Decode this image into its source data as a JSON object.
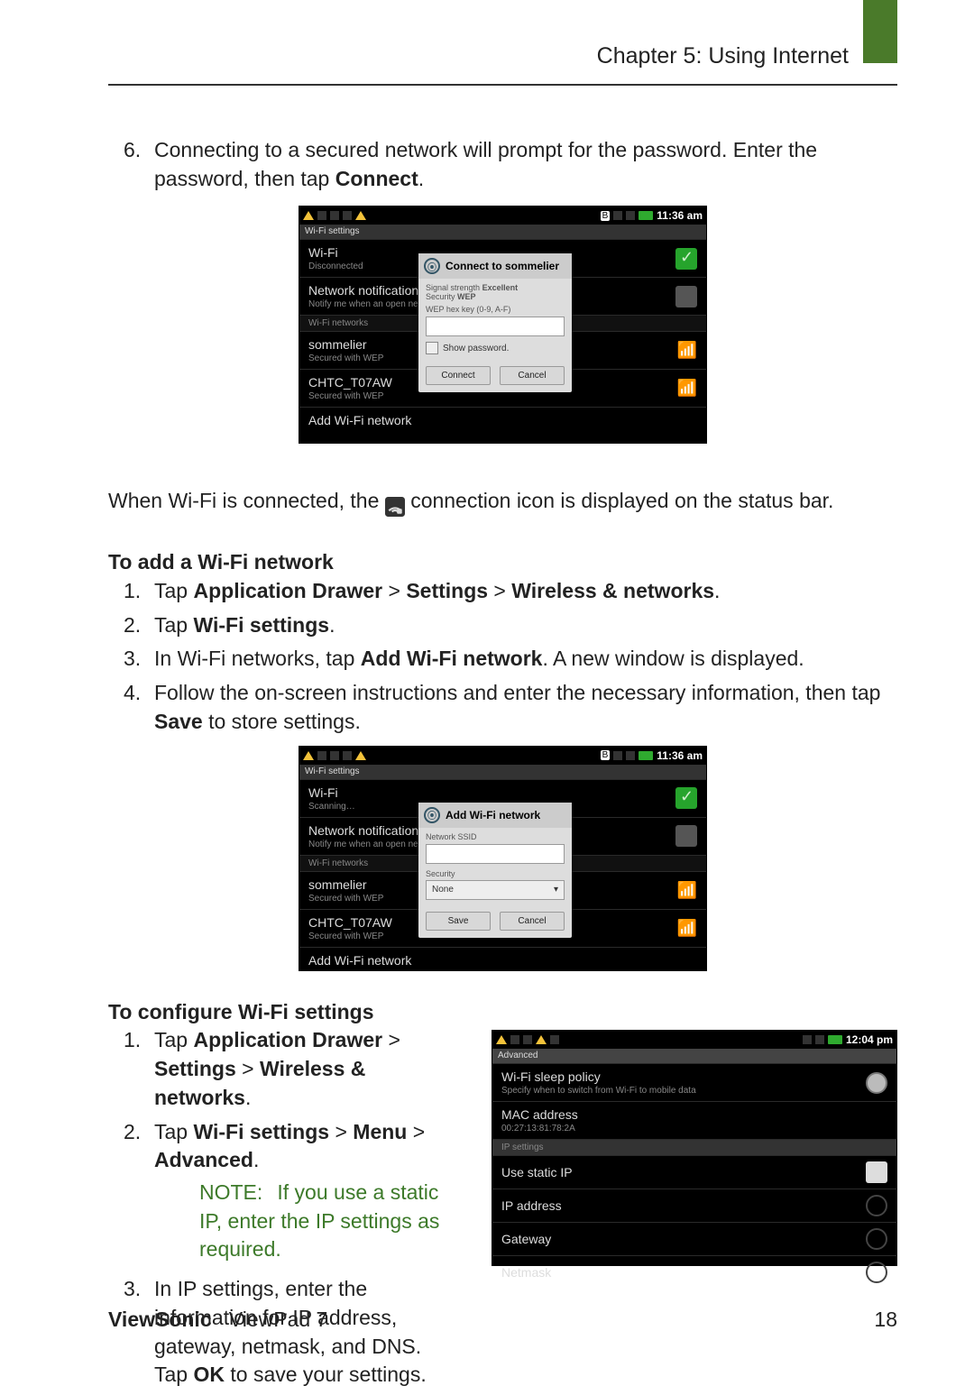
{
  "header": {
    "chapter_title": "Chapter 5: Using Internet"
  },
  "p_intro": {
    "num": "6.",
    "text_a": "Connecting to a secured network will prompt for the password. Enter the password, then tap ",
    "bold": "Connect",
    "text_b": "."
  },
  "screenshot1": {
    "time": "11:36 am",
    "titlebar": "Wi-Fi settings",
    "rows": {
      "wifi_title": "Wi-Fi",
      "wifi_sub": "Disconnected",
      "notif_title": "Network notification",
      "notif_sub": "Notify me when an open network is a…",
      "section_label": "Wi-Fi networks",
      "net1_title": "sommelier",
      "net1_sub": "Secured with WEP",
      "net2_title": "CHTC_T07AW",
      "net2_sub": "Secured with WEP",
      "add_title": "Add Wi-Fi network"
    },
    "dialog": {
      "title": "Connect to sommelier",
      "line1a": "Signal strength",
      "line1b": "Excellent",
      "line2a": "Security",
      "line2b": "WEP",
      "line3": "WEP hex key (0-9, A-F)",
      "show_pw": "Show password.",
      "btn_ok": "Connect",
      "btn_cancel": "Cancel"
    }
  },
  "p_connected": {
    "a": "When Wi-Fi is connected, the ",
    "b": " connection icon is displayed on the status bar."
  },
  "add_section": {
    "heading": "To add a Wi-Fi network",
    "s1": {
      "num": "1.",
      "a": "Tap ",
      "b1": "Application Drawer",
      "b2": "Settings",
      "b3": "Wireless & networks",
      "gt": " > ",
      "end": "."
    },
    "s2": {
      "num": "2.",
      "a": "Tap ",
      "b": "Wi-Fi settings",
      "end": "."
    },
    "s3": {
      "num": "3.",
      "a": "In Wi-Fi networks, tap ",
      "b": "Add Wi-Fi network",
      "c": ". A new window is displayed."
    },
    "s4": {
      "num": "4.",
      "a": "Follow the on-screen instructions and enter the necessary information, then tap ",
      "b": "Save",
      "c": " to store settings."
    }
  },
  "screenshot2": {
    "time": "11:36 am",
    "titlebar": "Wi-Fi settings",
    "rows": {
      "wifi_title": "Wi-Fi",
      "wifi_sub": "Scanning…",
      "notif_title": "Network notification",
      "notif_sub": "Notify me when an open network is a…",
      "section_label": "Wi-Fi networks",
      "net1_title": "sommelier",
      "net1_sub": "Secured with WEP",
      "net2_title": "CHTC_T07AW",
      "net2_sub": "Secured with WEP",
      "add_title": "Add Wi-Fi network"
    },
    "dialog": {
      "title": "Add Wi-Fi network",
      "lbl_ssid": "Network SSID",
      "lbl_sec": "Security",
      "sec_value": "None",
      "btn_ok": "Save",
      "btn_cancel": "Cancel"
    }
  },
  "config_section": {
    "heading": "To configure Wi-Fi settings",
    "s1": {
      "num": "1.",
      "a": "Tap ",
      "b1": "Application Drawer",
      "b2": "Settings",
      "b3": "Wireless & networks",
      "gt": " > ",
      "end": "."
    },
    "s2": {
      "num": "2.",
      "a": "Tap ",
      "b1": "Wi-Fi settings",
      "b2": "Menu",
      "b3": "Advanced",
      "gt": " > ",
      "end": "."
    },
    "note": {
      "label": "NOTE:",
      "text": " If you use a static IP, enter the IP settings as required."
    },
    "s3": {
      "num": "3.",
      "a": "In IP settings, enter the information for IP address, gateway, netmask, and DNS. Tap ",
      "b": "OK",
      "c": " to save your settings."
    }
  },
  "screenshot3": {
    "time": "12:04 pm",
    "titlebar": "Advanced",
    "rows": {
      "sleep_title": "Wi-Fi sleep policy",
      "sleep_sub": "Specify when to switch from Wi-Fi to mobile data",
      "mac_title": "MAC address",
      "mac_sub": "00:27:13:81:78:2A",
      "section_label": "IP settings",
      "static_title": "Use static IP",
      "ip_title": "IP address",
      "gateway_title": "Gateway",
      "netmask_title": "Netmask"
    }
  },
  "footer": {
    "brand": "ViewSonic",
    "product": "ViewPad 7",
    "pagenum": "18"
  }
}
